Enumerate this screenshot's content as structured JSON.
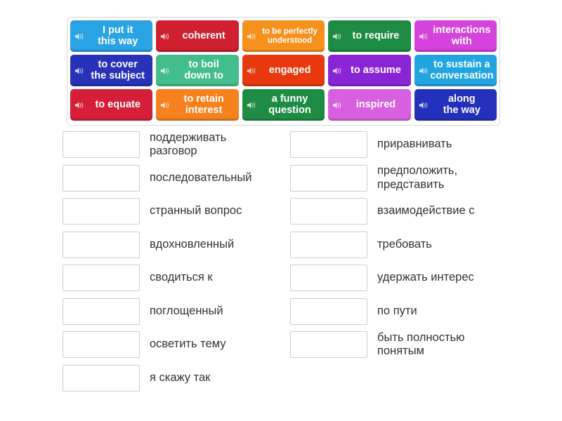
{
  "activity": {
    "type": "match-up",
    "audio_icon": "speaker-icon"
  },
  "tile_bank": {
    "rows": [
      [
        {
          "label": "I put it\nthis way",
          "color": "#29a3e3",
          "size": "normal"
        },
        {
          "label": "coherent",
          "color": "#cf2030",
          "size": "normal"
        },
        {
          "label": "to be perfectly\nunderstood",
          "color": "#f7911e",
          "size": "small"
        },
        {
          "label": "to require",
          "color": "#1e8b43",
          "size": "normal"
        },
        {
          "label": "interactions\nwith",
          "color": "#d642dc",
          "size": "normal"
        }
      ],
      [
        {
          "label": "to cover\nthe subject",
          "color": "#2732b8",
          "size": "normal"
        },
        {
          "label": "to boil\ndown to",
          "color": "#43bd8b",
          "size": "normal"
        },
        {
          "label": "engaged",
          "color": "#e8380d",
          "size": "normal"
        },
        {
          "label": "to assume",
          "color": "#8a25d6",
          "size": "normal"
        },
        {
          "label": "to sustain a\nconversation",
          "color": "#21a5e0",
          "size": "normal"
        }
      ],
      [
        {
          "label": "to equate",
          "color": "#d51f38",
          "size": "normal"
        },
        {
          "label": "to retain\ninterest",
          "color": "#f5821f",
          "size": "normal"
        },
        {
          "label": "a funny\nquestion",
          "color": "#1f8c45",
          "size": "normal"
        },
        {
          "label": "inspired",
          "color": "#d860e0",
          "size": "normal"
        },
        {
          "label": "along\nthe way",
          "color": "#2230bb",
          "size": "normal"
        }
      ]
    ]
  },
  "answers": {
    "left_column": [
      {
        "text": "поддерживать\nразговор",
        "dropped": ""
      },
      {
        "text": "последовательный",
        "dropped": ""
      },
      {
        "text": "странный вопрос",
        "dropped": ""
      },
      {
        "text": "вдохновленный",
        "dropped": ""
      },
      {
        "text": "сводиться к",
        "dropped": ""
      },
      {
        "text": "поглощенный",
        "dropped": ""
      },
      {
        "text": "осветить тему",
        "dropped": ""
      },
      {
        "text": "я скажу так",
        "dropped": ""
      }
    ],
    "right_column": [
      {
        "text": "приравнивать",
        "dropped": ""
      },
      {
        "text": "предположить,\nпредставить",
        "dropped": ""
      },
      {
        "text": "взаимодействие с",
        "dropped": ""
      },
      {
        "text": "требовать",
        "dropped": ""
      },
      {
        "text": "удержать интерес",
        "dropped": ""
      },
      {
        "text": "по пути",
        "dropped": ""
      },
      {
        "text": "быть полностью\nпонятым",
        "dropped": ""
      }
    ]
  }
}
